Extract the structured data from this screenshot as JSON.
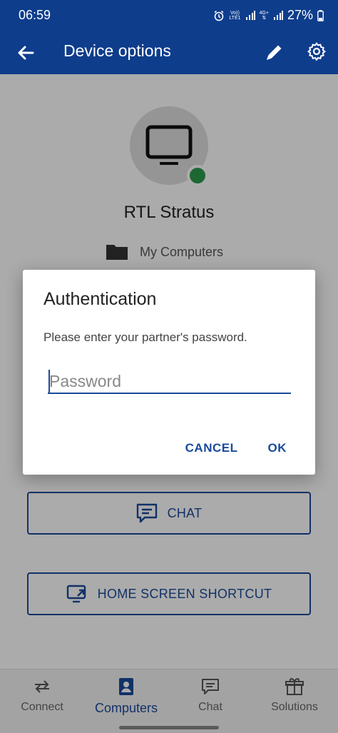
{
  "status_bar": {
    "time": "06:59",
    "network_top": "Vo))",
    "network_bottom": "LTE1",
    "net2_top": "4G+",
    "battery": "27%"
  },
  "app_bar": {
    "title": "Device options"
  },
  "device": {
    "name": "RTL Stratus",
    "group": "My Computers",
    "status": "online"
  },
  "actions": {
    "chat": "CHAT",
    "shortcut": "HOME SCREEN SHORTCUT"
  },
  "dialog": {
    "title": "Authentication",
    "message": "Please enter your partner's password.",
    "password_placeholder": "Password",
    "password_value": "",
    "cancel": "CANCEL",
    "ok": "OK"
  },
  "bottom_nav": {
    "items": [
      {
        "label": "Connect",
        "icon": "swap-arrows-icon",
        "active": false
      },
      {
        "label": "Computers",
        "icon": "contacts-icon",
        "active": true
      },
      {
        "label": "Chat",
        "icon": "chat-icon",
        "active": false
      },
      {
        "label": "Solutions",
        "icon": "gift-icon",
        "active": false
      }
    ]
  },
  "colors": {
    "brand": "#0e3d8c",
    "accent": "#1a4a9a",
    "online": "#2c9a4d"
  }
}
